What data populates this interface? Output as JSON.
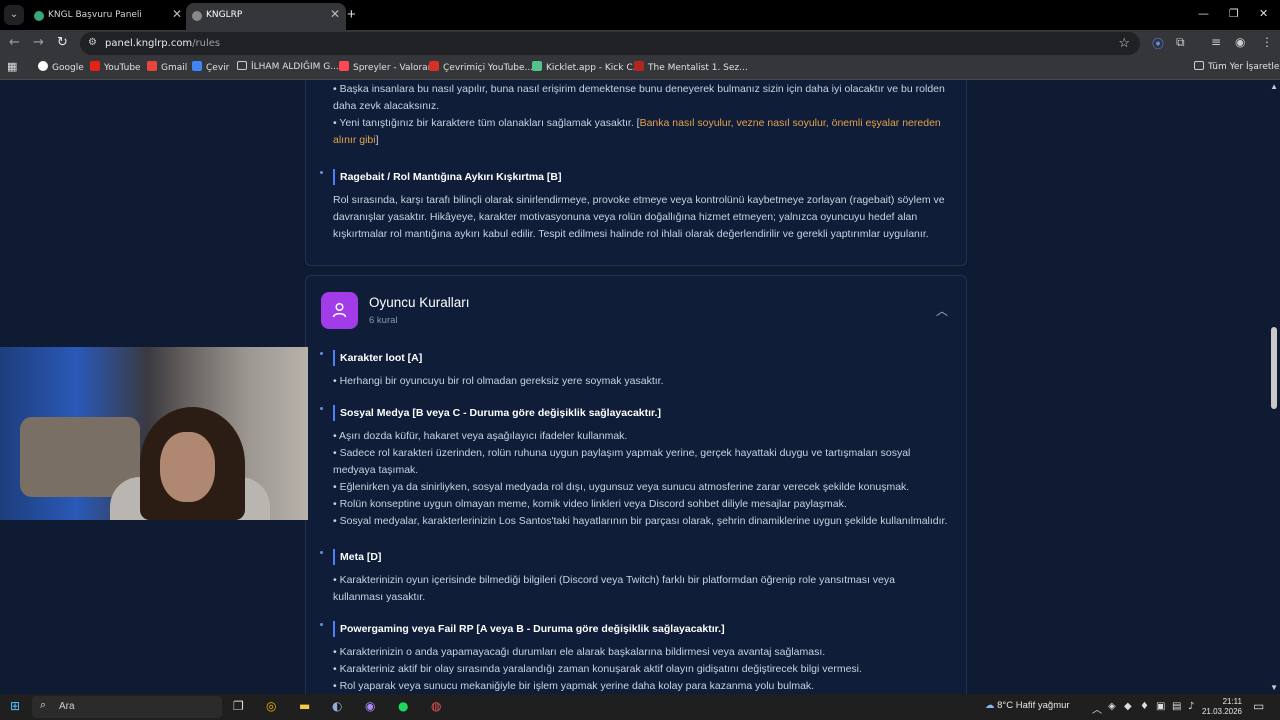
{
  "browser": {
    "tabs": [
      {
        "title": "KNGL Başvuru Paneli",
        "active": false
      },
      {
        "title": "KNGLRP",
        "active": true
      }
    ],
    "url_host": "panel.knglrp.com",
    "url_path": "/rules",
    "bookmarks": [
      "Google",
      "YouTube",
      "Gmail",
      "Çevir",
      "İLHAM ALDIĞIM G...",
      "Spreyler - Valorant",
      "Çevrimiçi YouTube...",
      "Kicklet.app - Kick C...",
      "The Mentalist 1. Sez..."
    ],
    "all_bookmarks": "Tüm Yer İşaretleri"
  },
  "card1": {
    "lines": [
      "• Başka insanlara bu nasıl yapılır, buna nasıl erişirim demektense bunu deneyerek bulmanız sizin için daha iyi olacaktır ve bu rolden",
      "daha zevk alacaksınız.",
      "• Yeni tanıştığınız bir karaktere tüm olanakları sağlamak yasaktır. ["
    ],
    "highlight_1": "Banka nasıl soyulur, vezne nasıl soyulur, önemli eşyalar nereden",
    "highlight_2": "alınır gibi",
    "close_bracket": "]",
    "rule_title": "Ragebait / Rol Mantığına Aykırı Kışkırtma [B]",
    "rule_body": [
      "Rol sırasında, karşı tarafı bilinçli olarak sinirlendirmeye, provoke etmeye veya kontrolünü kaybetmeye zorlayan (ragebait) söylem ve",
      "davranışlar yasaktır. Hikâyeye, karakter motivasyonuna veya rolün doğallığına hizmet etmeyen; yalnızca oyuncuyu hedef alan",
      "kışkırtmalar rol mantığına aykırı kabul edilir. Tespit edilmesi halinde rol ihlali olarak değerlendirilir ve gerekli yaptırımlar uygulanır."
    ]
  },
  "section": {
    "title": "Oyuncu Kuralları",
    "count": "6 kural",
    "rules": [
      {
        "title": "Karakter loot [A]",
        "lines": [
          "• Herhangi bir oyuncuyu bir rol olmadan gereksiz yere soymak yasaktır."
        ]
      },
      {
        "title": "Sosyal Medya [B veya C - Duruma göre değişiklik sağlayacaktır.]",
        "lines": [
          "• Aşırı dozda küfür, hakaret veya aşağılayıcı ifadeler kullanmak.",
          "• Sadece rol karakteri üzerinden, rolün ruhuna uygun paylaşım yapmak yerine, gerçek hayattaki duygu ve tartışmaları sosyal",
          "medyaya taşımak.",
          "• Eğlenirken ya da sinirliyken, sosyal medyada rol dışı, uygunsuz veya sunucu atmosferine zarar verecek şekilde konuşmak.",
          "• Rolün konseptine uygun olmayan meme, komik video linkleri veya Discord sohbet diliyle mesajlar paylaşmak.",
          "• Sosyal medyalar, karakterlerinizin Los Santos'taki hayatlarının bir parçası olarak, şehrin dinamiklerine uygun şekilde kullanılmalıdır."
        ]
      },
      {
        "title": "Meta [D]",
        "lines": [
          "• Karakterinizin oyun içerisinde bilmediği bilgileri (Discord veya Twitch) farklı bir platformdan öğrenip role yansıtması veya",
          "kullanması yasaktır."
        ]
      },
      {
        "title": "Powergaming veya Fail RP [A veya B - Duruma göre değişiklik sağlayacaktır.]",
        "lines": [
          "• Karakterinizin o anda yapamayacağı durumları ele alarak başkalarına bildirmesi veya avantaj sağlaması.",
          "• Karakteriniz aktif bir olay sırasında yaralandığı zaman konuşarak aktif olayın gidişatını değiştirecek bilgi vermesi.",
          "• Rol yaparak veya sunucu mekaniğiyle bir işlem yapmak yerine daha kolay para kazanma yolu bulmak."
        ]
      }
    ]
  },
  "taskbar": {
    "search_placeholder": "Ara",
    "weather": "8°C  Hafif yağmur",
    "time": "21:11",
    "date": "21.03.2026"
  },
  "colors": {
    "accent_purple": "#a23be8",
    "rule_bar": "#4d7fff",
    "highlight": "#e5a24a",
    "page_bg": "#0f1b33"
  }
}
